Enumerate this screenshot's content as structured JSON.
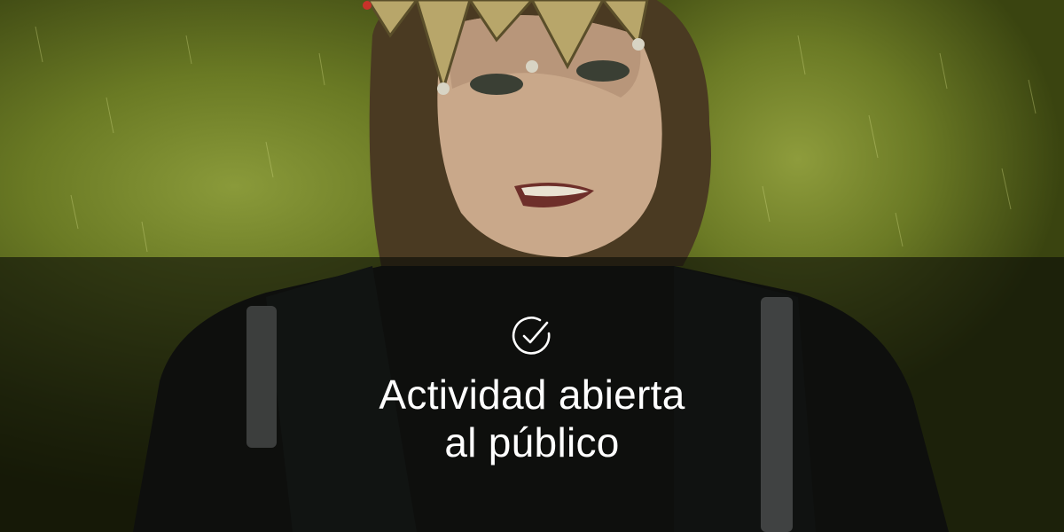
{
  "banner": {
    "icon": "check-circle-icon",
    "title_line1": "Actividad abierta",
    "title_line2": "al público"
  },
  "colors": {
    "background": "#6a7a24",
    "overlay": "#0a0c06",
    "text": "#ffffff"
  }
}
